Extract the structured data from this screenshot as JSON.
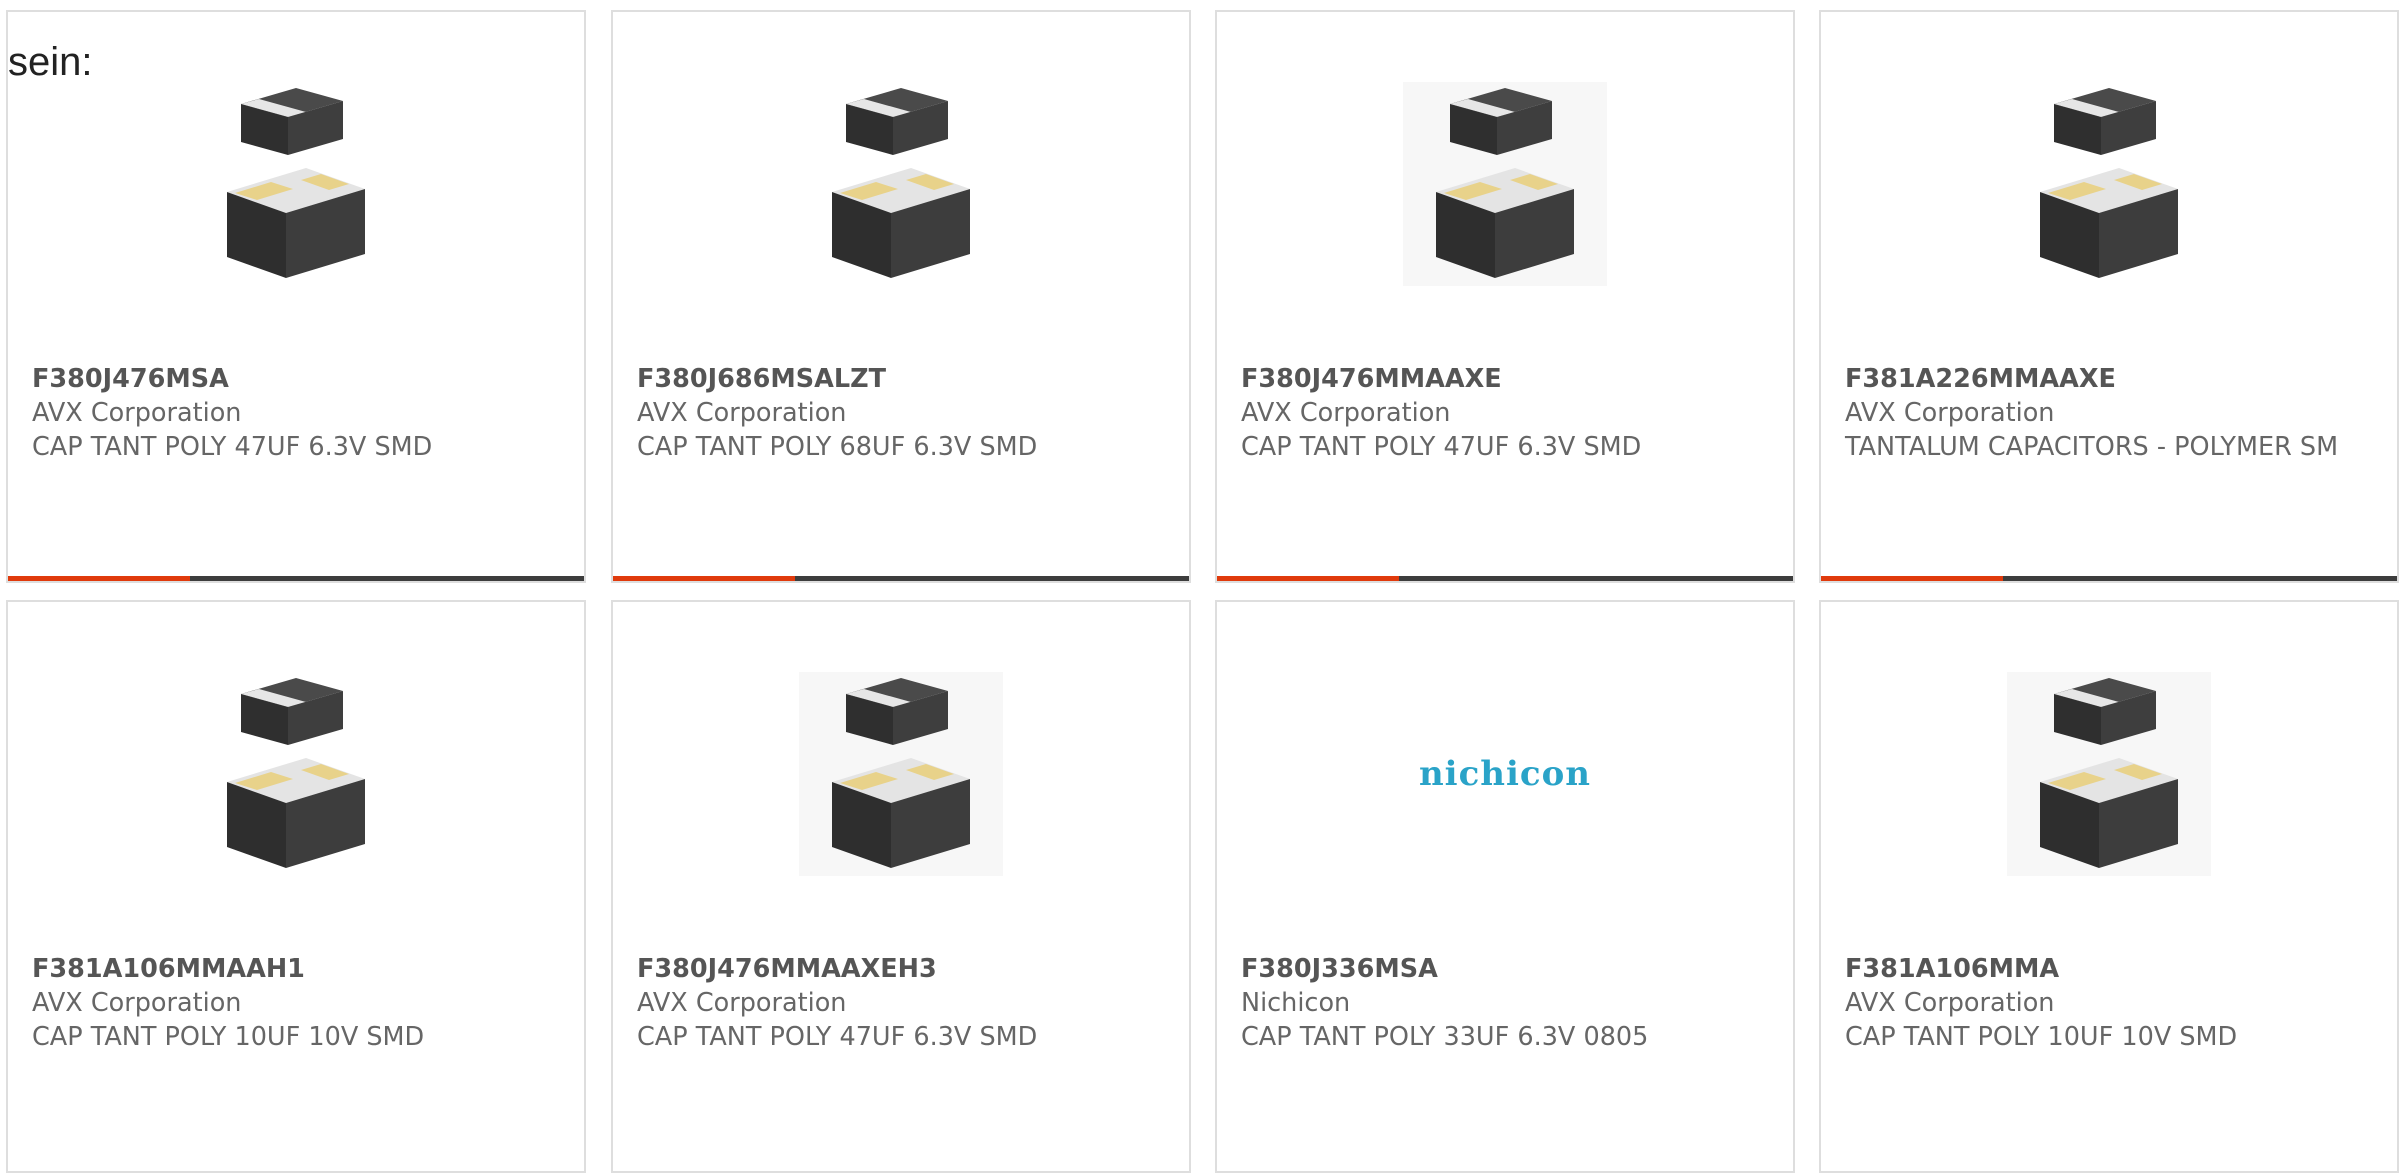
{
  "intro_text": "sein:",
  "products": [
    {
      "part_number": "F380J476MSA",
      "manufacturer": "AVX Corporation",
      "description": "CAP TANT POLY 47UF 6.3V SMD",
      "image": "chip-capacitor-render",
      "has_bar": true
    },
    {
      "part_number": "F380J686MSALZT",
      "manufacturer": "AVX Corporation",
      "description": "CAP TANT POLY 68UF 6.3V SMD",
      "image": "chip-capacitor-render",
      "has_bar": true
    },
    {
      "part_number": "F380J476MMAAXE",
      "manufacturer": "AVX Corporation",
      "description": "CAP TANT POLY 47UF 6.3V SMD",
      "image": "chip-capacitor-render",
      "has_bar": true
    },
    {
      "part_number": "F381A226MMAAXE",
      "manufacturer": "AVX Corporation",
      "description": "TANTALUM CAPACITORS - POLYMER SM",
      "image": "chip-capacitor-render",
      "has_bar": true
    },
    {
      "part_number": "F381A106MMAAH1",
      "manufacturer": "AVX Corporation",
      "description": "CAP TANT POLY 10UF 10V SMD",
      "image": "chip-capacitor-render",
      "has_bar": false
    },
    {
      "part_number": "F380J476MMAAXEH3",
      "manufacturer": "AVX Corporation",
      "description": "CAP TANT POLY 47UF 6.3V SMD",
      "image": "chip-capacitor-render",
      "has_bar": false
    },
    {
      "part_number": "F380J336MSA",
      "manufacturer": "Nichicon",
      "description": "CAP TANT POLY 33UF 6.3V 0805",
      "image": "nichicon-logo",
      "logo_text": "nichicon",
      "has_bar": false
    },
    {
      "part_number": "F381A106MMA",
      "manufacturer": "AVX Corporation",
      "description": "CAP TANT POLY 10UF 10V SMD",
      "image": "chip-capacitor-render",
      "has_bar": false
    }
  ],
  "colors": {
    "accent": "#e03a0c",
    "bar_dark": "#3d3d3d",
    "border": "#dedede",
    "text": "#666666",
    "nichicon_blue": "#2aa3c8"
  }
}
